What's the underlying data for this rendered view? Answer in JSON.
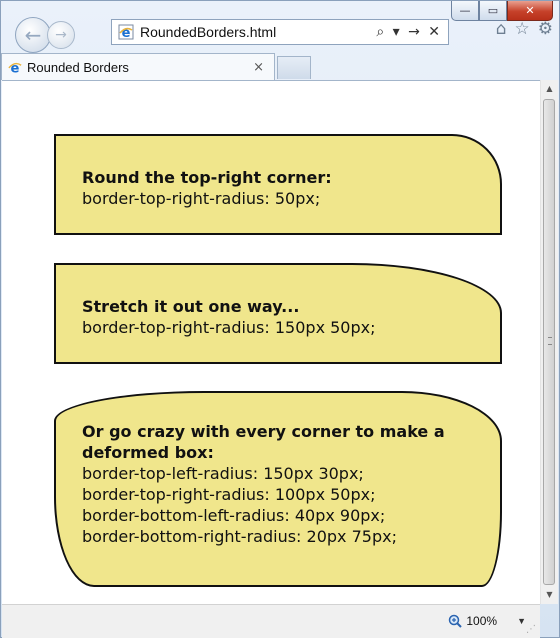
{
  "window": {
    "minimize_icon": "minimize-icon",
    "maximize_icon": "maximize-icon",
    "close_icon": "close-icon",
    "min_glyph": "—",
    "max_glyph": "▭",
    "close_glyph": "✕"
  },
  "nav": {
    "back_glyph": "←",
    "forward_glyph": "→"
  },
  "address_bar": {
    "url": "RoundedBorders.html",
    "controls": "⌕ ▾ → ✕"
  },
  "toolbar": {
    "home_icon": "home-icon",
    "favorites_icon": "star-icon",
    "tools_icon": "gear-icon",
    "home_glyph": "⌂",
    "star_glyph": "☆",
    "gear_glyph": "⚙"
  },
  "tab": {
    "title": "Rounded Borders",
    "close_glyph": "×"
  },
  "boxes": [
    {
      "heading": "Round the top-right corner:",
      "lines": [
        "border-top-right-radius: 50px;"
      ]
    },
    {
      "heading": "Stretch it out one way...",
      "lines": [
        "border-top-right-radius: 150px 50px;"
      ]
    },
    {
      "heading": "Or go crazy with every corner to make a deformed box:",
      "lines": [
        "border-top-left-radius: 150px 30px;",
        "border-top-right-radius: 100px 50px;",
        "border-bottom-left-radius: 40px 90px;",
        "border-bottom-right-radius: 20px 75px;"
      ]
    }
  ],
  "colors": {
    "box_fill": "#f0e68c",
    "box_border": "#111111"
  },
  "status_bar": {
    "zoom": "100%",
    "zoom_icon": "zoom-icon",
    "dropdown_glyph": "▼"
  },
  "scrollbar": {
    "up_glyph": "▲",
    "down_glyph": "▼"
  }
}
